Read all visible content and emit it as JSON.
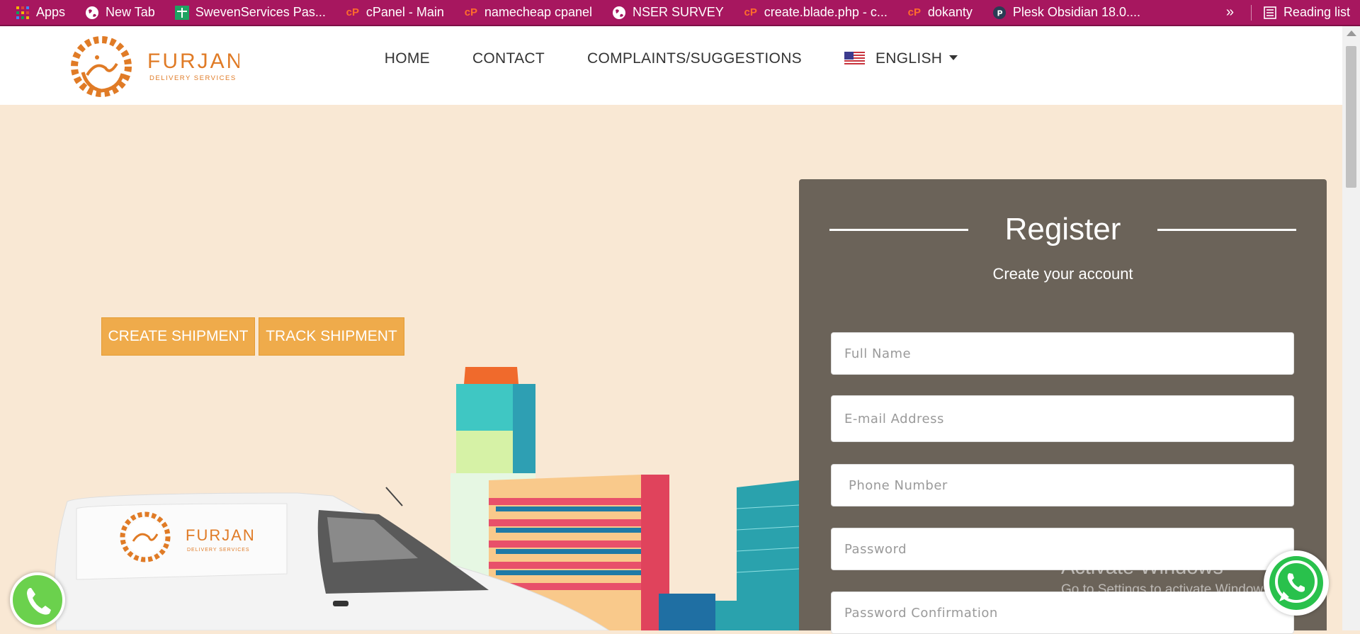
{
  "bookmarks": {
    "items": [
      {
        "label": "Apps",
        "icon": "apps-grid-icon"
      },
      {
        "label": "New Tab",
        "icon": "globe-icon"
      },
      {
        "label": "SwevenServices Pas...",
        "icon": "green-plus-icon"
      },
      {
        "label": "cPanel - Main",
        "icon": "cpanel-icon"
      },
      {
        "label": "namecheap cpanel",
        "icon": "cpanel-icon"
      },
      {
        "label": "NSER SURVEY",
        "icon": "globe-icon"
      },
      {
        "label": "create.blade.php - c...",
        "icon": "cpanel-icon"
      },
      {
        "label": "dokanty",
        "icon": "cpanel-icon"
      },
      {
        "label": "Plesk Obsidian 18.0....",
        "icon": "plesk-icon"
      }
    ],
    "overflow": "»",
    "reading_list": "Reading list"
  },
  "header": {
    "logo_text": "FURJAN",
    "logo_subtext": "DELIVERY SERVICES",
    "nav": {
      "home": "HOME",
      "contact": "CONTACT",
      "complaints": "COMPLAINTS/SUGGESTIONS",
      "language": "ENGLISH"
    }
  },
  "hero": {
    "create_shipment": "CREATE SHIPMENT",
    "track_shipment": "TRACK SHIPMENT"
  },
  "register": {
    "title": "Register",
    "subtitle": "Create your account",
    "fields": {
      "full_name": "Full Name",
      "email": "E-mail Address",
      "phone": "Phone Number",
      "password": "Password",
      "password_confirmation": "Password Confirmation"
    }
  },
  "watermark": {
    "line1": "Activate Windows",
    "line2": "Go to Settings to activate Windows."
  },
  "colors": {
    "bookmark_bar": "#a7175f",
    "hero_bg": "#f9e8d4",
    "cta": "#efab4b",
    "panel": "#6b6359",
    "brand_orange": "#e07b26"
  }
}
